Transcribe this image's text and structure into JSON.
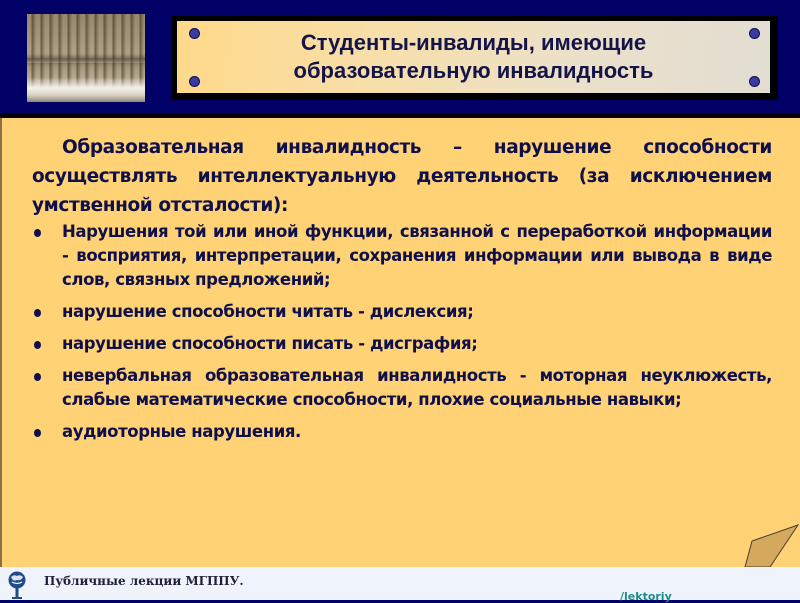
{
  "slide": {
    "title_lines": [
      "Студенты-инвалиды, имеющие",
      "образовательную инвалидность"
    ],
    "intro": "Образовательная инвалидность – нарушение способности осуществлять интеллектуальную деятельность (за исключением умственной отсталости):",
    "bullets": [
      "Нарушения той или иной функции, связанной с переработкой информации - восприятия, интерпретации, сохранения информации или вывода в виде слов, связных предложений;",
      "нарушение способности читать - дислексия;",
      "нарушение способности писать - дисграфия;",
      "невербальная образовательная инвалидность - моторная неуклюжесть, слабые математические способности, плохие социальные навыки;",
      "аудиоторные нарушения."
    ],
    "photo_icon": "book-pages-photo"
  },
  "footer": {
    "title": "Публичные лекции МГППУ.",
    "link_text": "/lektoriy",
    "logo_icon": "globe-microphone-logo"
  },
  "colors": {
    "header_bg": "#000066",
    "content_bg": "#ffd276",
    "text": "#0f0f4a",
    "footer_bg": "#eff4fc",
    "link": "#1a8e8a"
  }
}
